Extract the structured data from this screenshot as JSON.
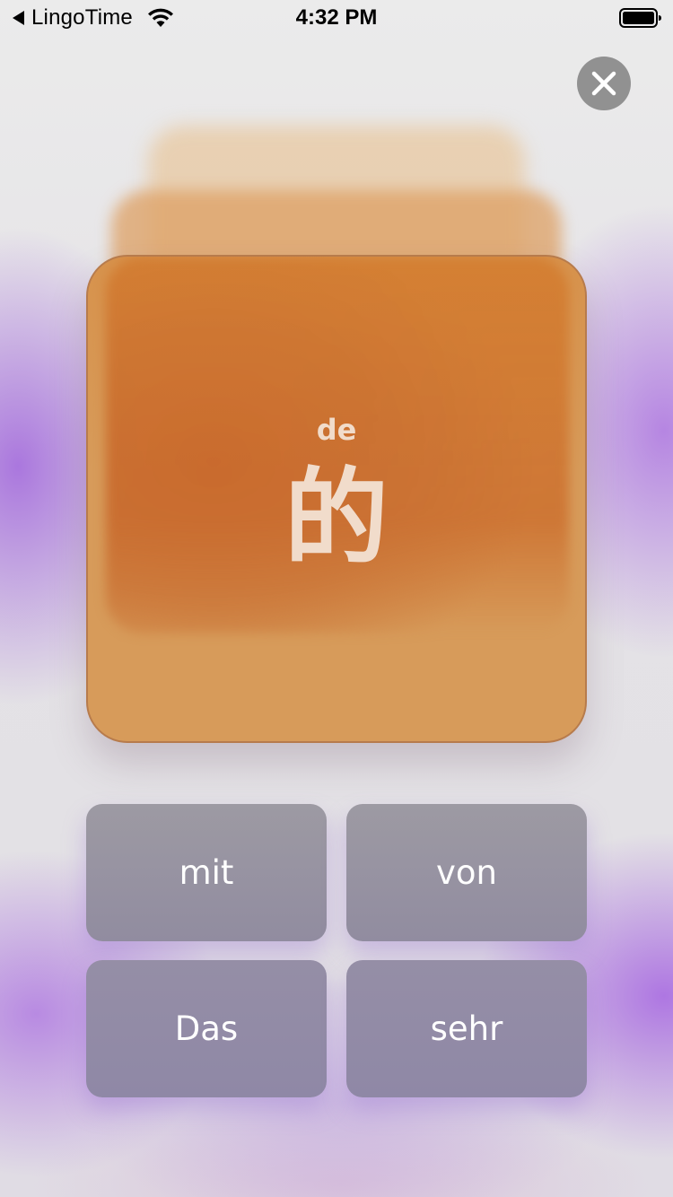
{
  "status_bar": {
    "back_app": "LingoTime",
    "time": "4:32 PM",
    "icons": [
      "back-arrow-icon",
      "wifi-icon",
      "battery-icon"
    ]
  },
  "close_button": {
    "icon": "close-icon",
    "color": "#919191"
  },
  "card": {
    "pinyin": "de",
    "character": "的",
    "color": "#d7813a"
  },
  "answers": [
    {
      "label": "mit"
    },
    {
      "label": "von"
    },
    {
      "label": "Das"
    },
    {
      "label": "sehr"
    }
  ],
  "colors": {
    "accent_purple": "#a36fe0",
    "answer_button": "#97929f",
    "card_text": "#f1dccb"
  }
}
